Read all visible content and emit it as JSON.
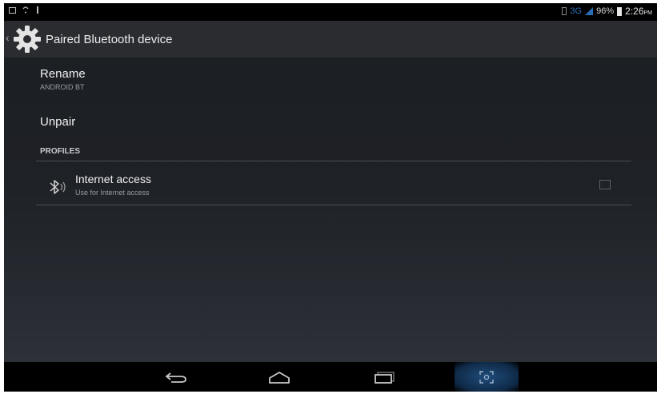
{
  "status_bar": {
    "network": "3G",
    "battery": "96%",
    "time": "2:26",
    "ampm": "PM"
  },
  "action_bar": {
    "title": "Paired Bluetooth device",
    "icon": "gear-icon"
  },
  "items": {
    "rename": {
      "title": "Rename",
      "subtitle": "ANDROID BT"
    },
    "unpair": {
      "title": "Unpair"
    }
  },
  "profiles": {
    "header": "PROFILES",
    "internet_access": {
      "title": "Internet access",
      "subtitle": "Use for Internet access",
      "icon": "bluetooth-icon",
      "checked": false
    }
  },
  "nav_bar": {
    "back": "back-icon",
    "home": "home-icon",
    "recents": "recents-icon",
    "screenshot": "screenshot-icon"
  },
  "colors": {
    "accent": "#2a6fb5",
    "background": "#1e2126",
    "text": "#f0f0f0"
  }
}
